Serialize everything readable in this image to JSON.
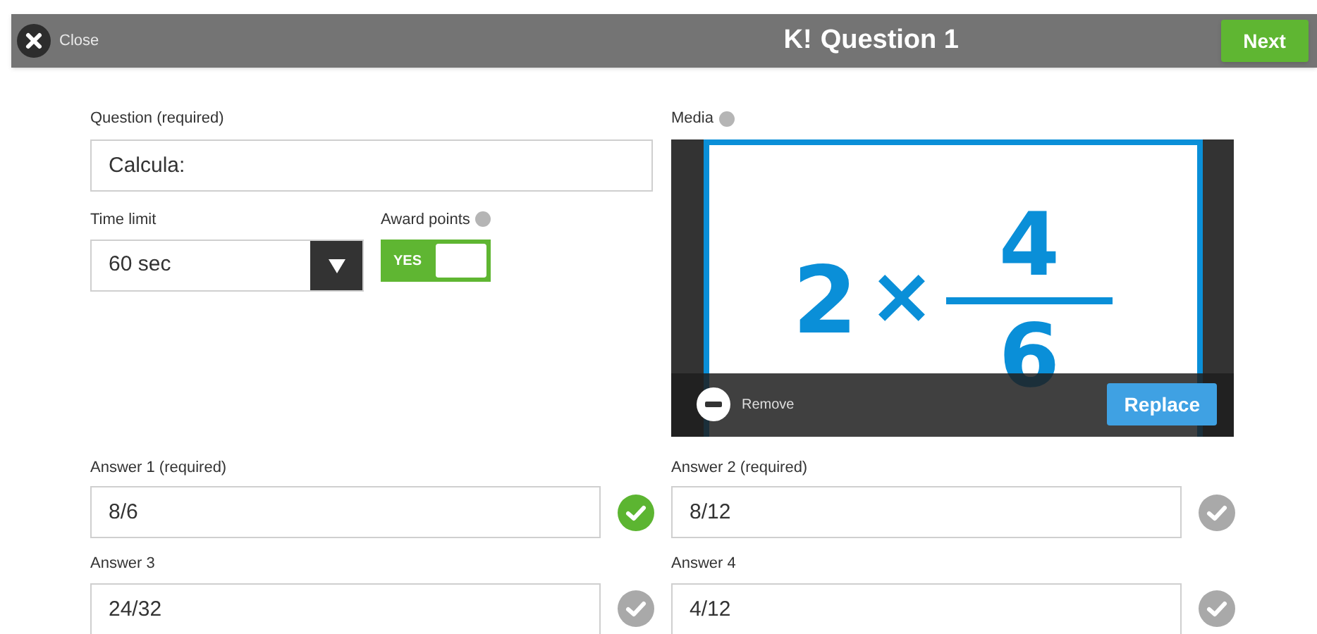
{
  "header": {
    "close": "Close",
    "logo": "K!",
    "title": "Question 1",
    "next": "Next"
  },
  "question": {
    "label": "Question (required)",
    "value": "Calcula:"
  },
  "time_limit": {
    "label": "Time limit",
    "value": "60 sec"
  },
  "award_points": {
    "label": "Award points",
    "on": true,
    "text": "YES"
  },
  "media": {
    "label": "Media",
    "image": {
      "whole": "2",
      "operator": "×",
      "numerator": "4",
      "denominator": "6"
    },
    "remove": "Remove",
    "replace": "Replace"
  },
  "answers": [
    {
      "label": "Answer 1 (required)",
      "value": "8/6",
      "correct": true
    },
    {
      "label": "Answer 2 (required)",
      "value": "8/12",
      "correct": false
    },
    {
      "label": "Answer 3",
      "value": "24/32",
      "correct": false
    },
    {
      "label": "Answer 4",
      "value": "4/12",
      "correct": false
    }
  ]
}
